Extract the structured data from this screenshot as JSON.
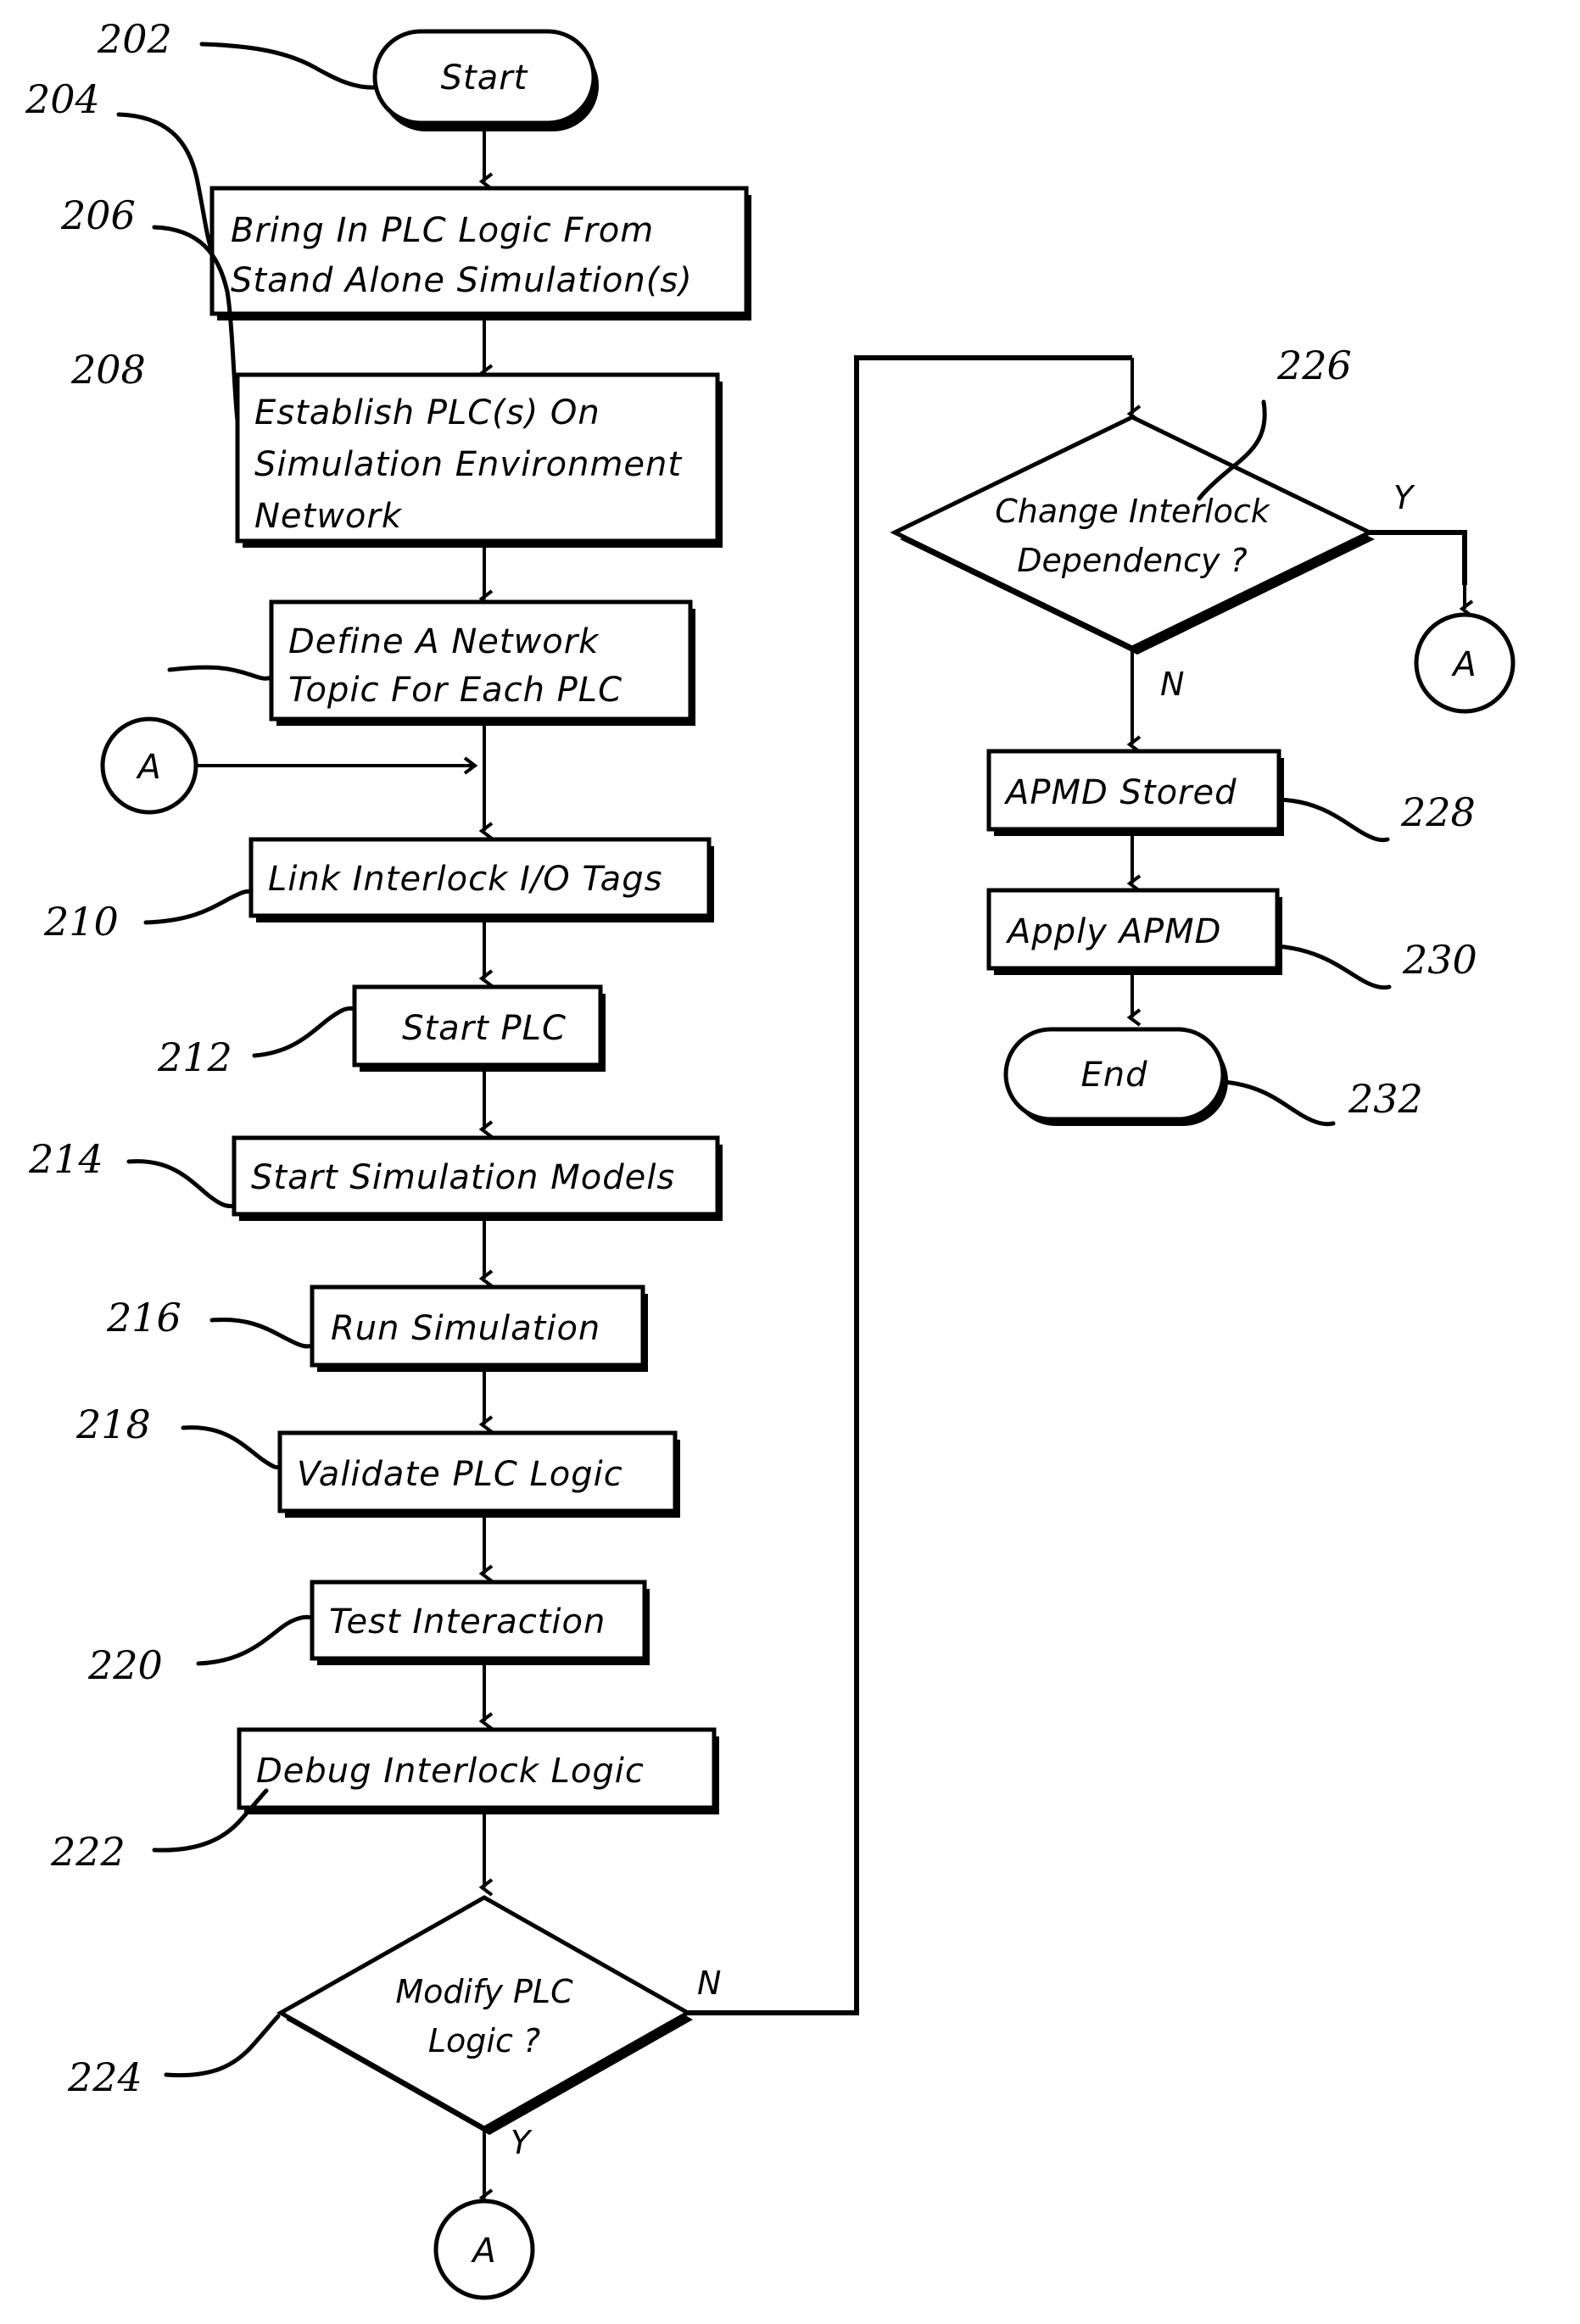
{
  "figure": {
    "type": "patent-flowchart",
    "title": "",
    "nodes": [
      {
        "id": "202",
        "ref": "202",
        "kind": "terminator",
        "label": "Start"
      },
      {
        "id": "204",
        "ref": "204",
        "kind": "process",
        "line1": "Bring In PLC Logic From",
        "line2": "Stand Alone Simulation(s)"
      },
      {
        "id": "206",
        "ref": "206",
        "kind": "process",
        "line1": "Establish PLC(s) On",
        "line2": "Simulation Environment",
        "line3": "Network"
      },
      {
        "id": "208",
        "ref": "208",
        "kind": "process",
        "line1": "Define A Network",
        "line2": "Topic For Each PLC"
      },
      {
        "id": "210",
        "ref": "210",
        "kind": "process",
        "line1": "Link Interlock I/O Tags"
      },
      {
        "id": "212",
        "ref": "212",
        "kind": "process",
        "line1": "Start PLC"
      },
      {
        "id": "214",
        "ref": "214",
        "kind": "process",
        "line1": "Start Simulation Models"
      },
      {
        "id": "216",
        "ref": "216",
        "kind": "process",
        "line1": "Run Simulation"
      },
      {
        "id": "218",
        "ref": "218",
        "kind": "process",
        "line1": "Validate PLC Logic"
      },
      {
        "id": "220",
        "ref": "220",
        "kind": "process",
        "line1": "Test Interaction"
      },
      {
        "id": "222",
        "ref": "222",
        "kind": "process",
        "line1": "Debug Interlock Logic"
      },
      {
        "id": "224",
        "ref": "224",
        "kind": "decision",
        "line1": "Modify PLC",
        "line2": "Logic ?",
        "yes": "Y",
        "no": "N"
      },
      {
        "id": "226",
        "ref": "226",
        "kind": "decision",
        "line1": "Change Interlock",
        "line2": "Dependency ?",
        "yes": "Y",
        "no": "N"
      },
      {
        "id": "228",
        "ref": "228",
        "kind": "process",
        "line1": "APMD Stored"
      },
      {
        "id": "230",
        "ref": "230",
        "kind": "process",
        "line1": "Apply APMD"
      },
      {
        "id": "232",
        "ref": "232",
        "kind": "terminator",
        "label": "End"
      }
    ],
    "connectors": [
      {
        "id": "conn-a-left",
        "letter": "A"
      },
      {
        "id": "conn-a-bottom",
        "letter": "A"
      },
      {
        "id": "conn-a-right",
        "letter": "A"
      }
    ],
    "branch_labels": {
      "d224_no": "N",
      "d224_yes": "Y",
      "d226_yes": "Y",
      "d226_no": "N"
    },
    "colors": {
      "stroke": "#000000",
      "fill": "#ffffff",
      "background": "#ffffff"
    }
  }
}
